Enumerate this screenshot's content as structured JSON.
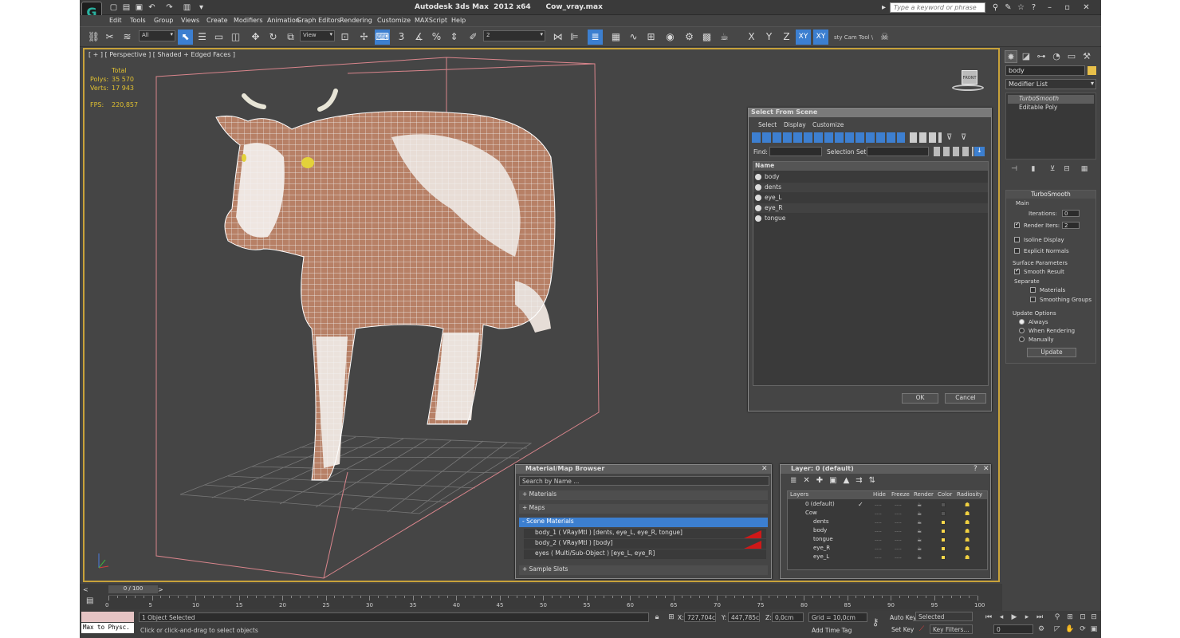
{
  "app": {
    "logo": "G",
    "title": "Autodesk 3ds Max  2012 x64      Cow_vray.max",
    "search_placeholder": "Type a keyword or phrase"
  },
  "menu": [
    "Edit",
    "Tools",
    "Group",
    "Views",
    "Create",
    "Modifiers",
    "Animation",
    "Graph Editors",
    "Rendering",
    "Customize",
    "MAXScript",
    "Help"
  ],
  "toolbar": {
    "filter": "All",
    "refcoord": "View",
    "selset": "2",
    "cam_tool": "sty Cam Tool \\",
    "axes": [
      "X",
      "Y",
      "Z",
      "XY",
      "XY"
    ]
  },
  "viewport": {
    "label": "[ + ] [ Perspective ] [ Shaded + Edged Faces ]",
    "stats": {
      "total_label": "Total",
      "polys_label": "Polys:",
      "polys": "35 570",
      "verts_label": "Verts:",
      "verts": "17 943",
      "fps_label": "FPS:",
      "fps": "220,857"
    },
    "viewcube": "FRONT"
  },
  "cmd": {
    "object_name": "body",
    "modifier_list": "Modifier List",
    "stack": [
      "TurboSmooth",
      "Editable Poly"
    ],
    "turbosmooth": {
      "title": "TurboSmooth",
      "main": "Main",
      "iterations_label": "Iterations:",
      "iterations": "0",
      "render_iters_label": "Render Iters:",
      "render_iters": "2",
      "isoline": "Isoline Display",
      "explicit": "Explicit Normals",
      "surface": "Surface Parameters",
      "smooth": "Smooth Result",
      "separate": "Separate",
      "materials": "Materials",
      "smoothing": "Smoothing Groups",
      "update_options": "Update Options",
      "always": "Always",
      "when_rendering": "When Rendering",
      "manually": "Manually",
      "update": "Update"
    }
  },
  "select_scene": {
    "title": "Select From Scene",
    "menus": [
      "Select",
      "Display",
      "Customize"
    ],
    "find": "Find:",
    "selset": "Selection Set:",
    "col_name": "Name",
    "items": [
      "body",
      "dents",
      "eye_L",
      "eye_R",
      "tongue"
    ],
    "ok": "OK",
    "cancel": "Cancel"
  },
  "matbrowser": {
    "title": "Material/Map Browser",
    "search": "Search by Name ...",
    "materials": "+ Materials",
    "maps": "+ Maps",
    "scene": "- Scene Materials",
    "rows": [
      "body_1  ( VRayMtl ) [dents, eye_L, eye_R, tongue]",
      "body_2  ( VRayMtl ) [body]",
      "eyes  ( Multi/Sub-Object ) [eye_L, eye_R]"
    ],
    "sample": "+ Sample Slots"
  },
  "layer": {
    "title": "Layer: 0 (default)",
    "cols": [
      "Layers",
      "Hide",
      "Freeze",
      "Render",
      "Color",
      "Radiosity"
    ],
    "rows": [
      "0 (default)",
      "Cow",
      "dents",
      "body",
      "tongue",
      "eye_R",
      "eye_L"
    ],
    "dashes": "----"
  },
  "timeline": {
    "frame": "0 / 100",
    "ticks": [
      "0",
      "5",
      "10",
      "15",
      "20",
      "25",
      "30",
      "35",
      "40",
      "45",
      "50",
      "55",
      "60",
      "65",
      "70",
      "75",
      "80",
      "85",
      "90",
      "95",
      "100"
    ]
  },
  "status": {
    "maxscript": "Max to Physc.",
    "selected": "1 Object Selected",
    "prompt": "Click or click-and-drag to select objects",
    "x_label": "X:",
    "x": "727,704cm",
    "y_label": "Y:",
    "y": "447,785cm",
    "z_label": "Z:",
    "z": "0,0cm",
    "grid": "Grid = 10,0cm",
    "add_tag": "Add Time Tag",
    "autokey": "Auto Key",
    "setkey": "Set Key",
    "selected_drop": "Selected",
    "keyfilters": "Key Filters...",
    "frame": "0"
  }
}
